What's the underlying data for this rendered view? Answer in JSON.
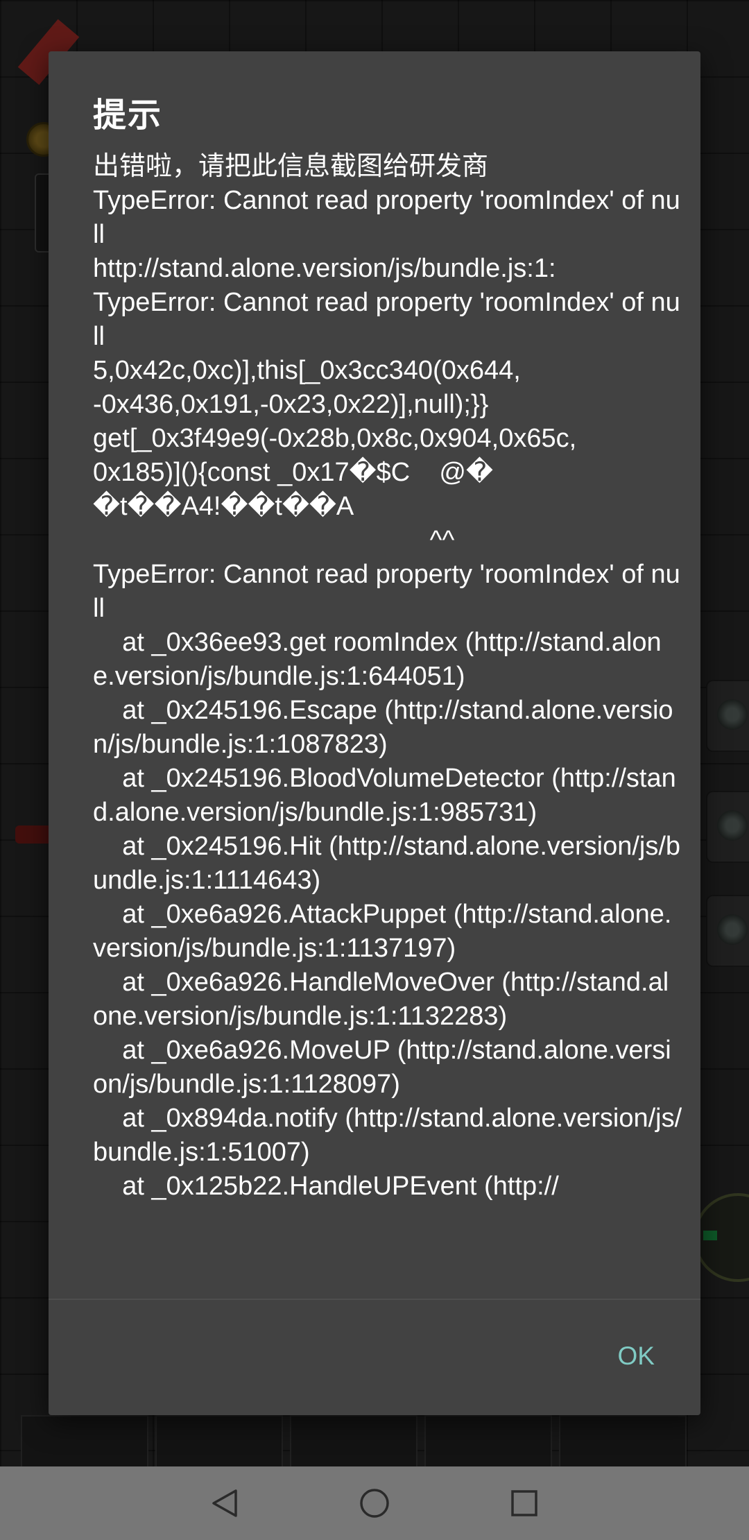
{
  "dialog": {
    "title": "提示",
    "message": "出错啦，请把此信息截图给研发商\nTypeError: Cannot read property 'roomIndex' of null\nhttp://stand.alone.version/js/bundle.js:1:\nTypeError: Cannot read property 'roomIndex' of null\n5,0x42c,0xc)],this[_0x3cc340(0x644,\n-0x436,0x191,-0x23,0x22)],null);}}\nget[_0x3f49e9(-0x28b,0x8c,0x904,0x65c,\n0x185)](){const _0x17�$C    @�\n�t��A4!��t��A\n                                              ^^\nTypeError: Cannot read property 'roomIndex' of null\n    at _0x36ee93.get roomIndex (http://stand.alone.version/js/bundle.js:1:644051)\n    at _0x245196.Escape (http://stand.alone.version/js/bundle.js:1:1087823)\n    at _0x245196.BloodVolumeDetector (http://stand.alone.version/js/bundle.js:1:985731)\n    at _0x245196.Hit (http://stand.alone.version/js/bundle.js:1:1114643)\n    at _0xe6a926.AttackPuppet (http://stand.alone.version/js/bundle.js:1:1137197)\n    at _0xe6a926.HandleMoveOver (http://stand.alone.version/js/bundle.js:1:1132283)\n    at _0xe6a926.MoveUP (http://stand.alone.version/js/bundle.js:1:1128097)\n    at _0x894da.notify (http://stand.alone.version/js/bundle.js:1:51007)\n    at _0x125b22.HandleUPEvent (http://",
    "ok_label": "OK"
  },
  "navbar": {
    "back_icon": "back-triangle-icon",
    "home_icon": "home-circle-icon",
    "recents_icon": "recents-square-icon"
  },
  "colors": {
    "dialog_bg": "#424242",
    "accent": "#80cbc4",
    "navbar_bg": "#777777"
  }
}
